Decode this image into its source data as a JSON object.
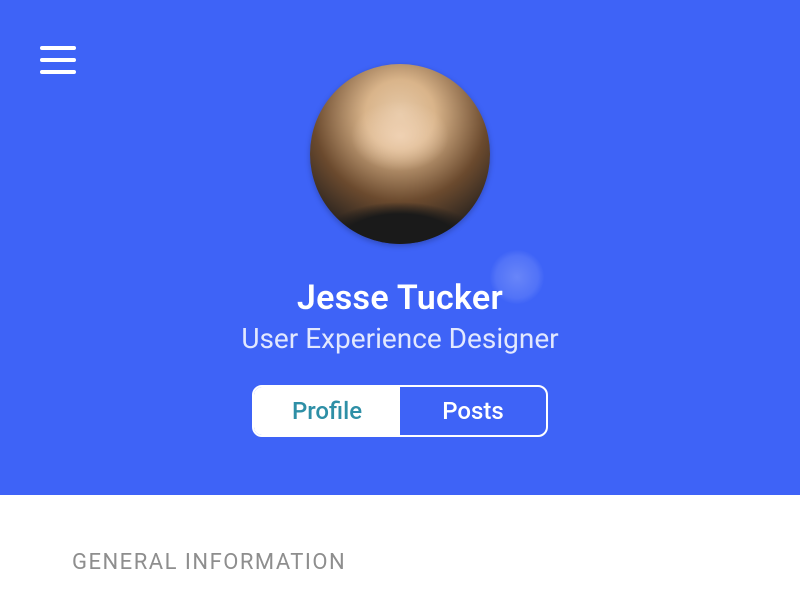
{
  "profile": {
    "name": "Jesse Tucker",
    "role": "User Experience Designer"
  },
  "tabs": {
    "profile_label": "Profile",
    "posts_label": "Posts",
    "active": "profile"
  },
  "sections": {
    "general_info_title": "GENERAL INFORMATION"
  },
  "icons": {
    "menu": "hamburger-icon"
  },
  "colors": {
    "primary": "#3E63F7",
    "tab_active_text": "#2E8FA6",
    "section_title": "#8E8E8E"
  }
}
